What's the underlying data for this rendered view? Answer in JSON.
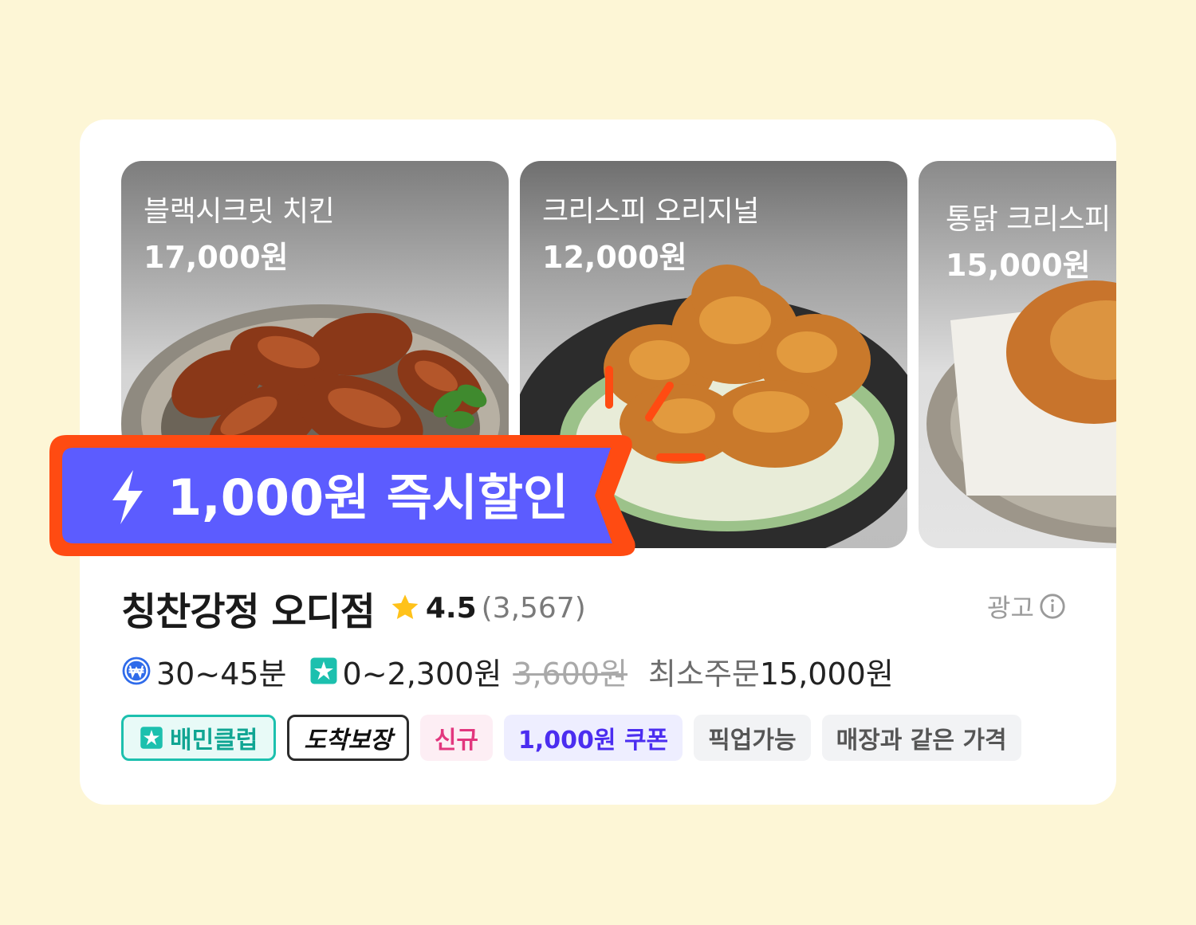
{
  "menu_items": [
    {
      "name": "블랙시크릿 치킨",
      "price": "17,000원"
    },
    {
      "name": "크리스피 오리지널",
      "price": "12,000원"
    },
    {
      "name": "통닭 크리스피",
      "price": "15,000원"
    }
  ],
  "promo_banner": {
    "label": "1,000원 즉시할인",
    "icon": "lightning-bolt-icon"
  },
  "store": {
    "name": "칭찬강정 오디점",
    "rating": "4.5",
    "review_count": "(3,567)",
    "ad_label": "광고"
  },
  "delivery_info": {
    "time": "30~45분",
    "fee": "0~2,300원",
    "original_fee": "3,600원",
    "min_order_label": "최소주문",
    "min_order_value": "15,000원"
  },
  "tags": {
    "club": "배민클럽",
    "arrival": "도착보장",
    "new": "신규",
    "coupon": "1,000원 쿠폰",
    "pickup": "픽업가능",
    "same_price": "매장과 같은 가격"
  },
  "colors": {
    "background": "#fdf6d6",
    "banner_fill": "#5c5cff",
    "banner_border": "#ff4b12",
    "club_teal": "#1cc0ae",
    "coupon_purple": "#4b2df0",
    "new_pink": "#e2377e",
    "star": "#ffc21a"
  }
}
